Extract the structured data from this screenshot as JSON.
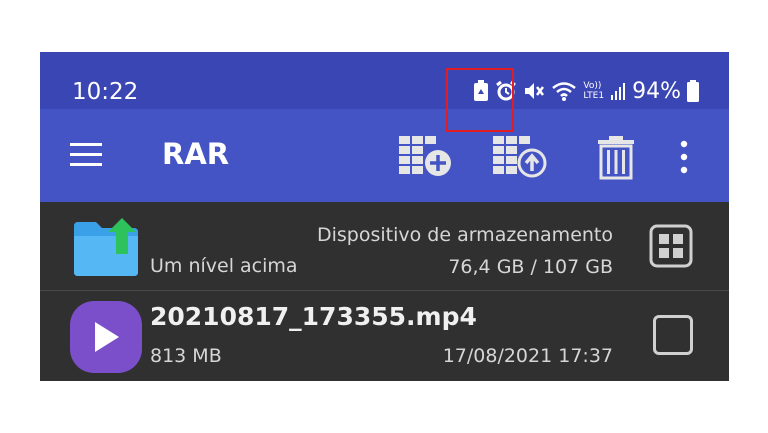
{
  "status_bar": {
    "time": "10:22",
    "battery_percent": "94%",
    "icons": [
      "battery-saver-icon",
      "alarm-icon",
      "mute-icon",
      "wifi-icon",
      "volte-icon",
      "signal-icon",
      "battery-icon"
    ],
    "network_label_top": "Vo))",
    "network_label_bottom": "LTE1"
  },
  "toolbar": {
    "title": "RAR",
    "buttons": [
      "menu-icon",
      "add-to-archive-icon",
      "extract-icon",
      "delete-icon",
      "more-options-icon"
    ],
    "background": "#4454c4",
    "highlight_color": "#e01c24"
  },
  "file_list": {
    "parent": {
      "label": "Um nível acima",
      "storage_name": "Dispositivo de armazenamento",
      "storage_size": "76,4 GB / 107 GB"
    },
    "items": [
      {
        "name": "20210817_173355.mp4",
        "size": "813 MB",
        "date": "17/08/2021 17:37",
        "icon": "video-play-icon",
        "checked": false
      }
    ]
  }
}
